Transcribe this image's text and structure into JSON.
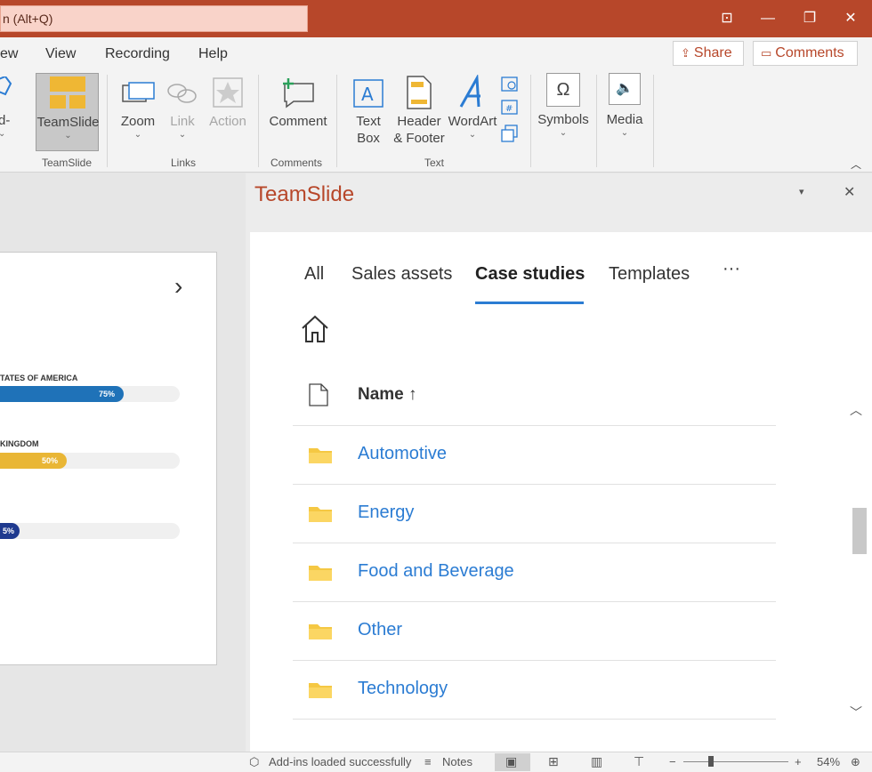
{
  "titlebar": {
    "search_text": "n (Alt+Q)",
    "buttons": {
      "restore_ribbon": "⊡",
      "minimize": "—",
      "maximize": "❐",
      "close": "✕"
    }
  },
  "ribbon_tabs": [
    "ew",
    "View",
    "Recording",
    "Help"
  ],
  "top_actions": {
    "share": "Share",
    "comments": "Comments"
  },
  "ribbon": {
    "partial_left_label": "d-",
    "groups": [
      {
        "label": "TeamSlide",
        "buttons": [
          "TeamSlide"
        ]
      },
      {
        "label": "Links",
        "buttons": [
          "Zoom",
          "Link",
          "Action"
        ]
      },
      {
        "label": "Comments",
        "buttons": [
          "Comment"
        ]
      },
      {
        "label": "Text",
        "buttons": [
          "Text\nBox",
          "Header\n& Footer",
          "WordArt"
        ]
      },
      {
        "label": "",
        "buttons": [
          "Symbols"
        ]
      },
      {
        "label": "",
        "buttons": [
          "Media"
        ]
      }
    ],
    "text_box_line1": "Text",
    "text_box_line2": "Box",
    "header_line1": "Header",
    "header_line2": "& Footer"
  },
  "slide": {
    "bars": [
      {
        "label": "TATES OF AMERICA",
        "value_label": "75%",
        "value": 0.69,
        "color": "#1f72b8"
      },
      {
        "label": "KINGDOM",
        "value_label": "50%",
        "value": 0.37,
        "color": "#e9b635"
      },
      {
        "label": "",
        "value_label": "5%",
        "value": 0.11,
        "color": "#1f3a8f"
      }
    ]
  },
  "pane": {
    "title": "TeamSlide",
    "tabs": [
      "All",
      "Sales assets",
      "Case studies",
      "Templates"
    ],
    "active_tab": "Case studies",
    "more": "···",
    "column_header": "Name ↑",
    "folders": [
      "Automotive",
      "Energy",
      "Food and Beverage",
      "Other",
      "Technology"
    ],
    "folder_color": "#f5c843"
  },
  "statusbar": {
    "addins": "Add-ins loaded successfully",
    "notes": "Notes",
    "zoom_minus": "−",
    "zoom_plus": "+",
    "zoom_level": "54%"
  },
  "colors": {
    "accent": "#b7472a",
    "link": "#2b7cd3"
  }
}
